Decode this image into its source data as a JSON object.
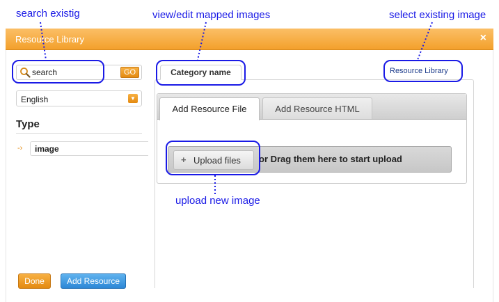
{
  "window": {
    "title": "Resource Library",
    "close_glyph": "×"
  },
  "sidebar": {
    "search_value": "search",
    "go_label": "GO",
    "language": "English",
    "type_heading": "Type",
    "type_items": [
      {
        "label": "image"
      }
    ]
  },
  "main": {
    "category_tab": "Category name",
    "resource_library_link": "Resource Library",
    "tabs": [
      {
        "label": "Add Resource File",
        "active": true
      },
      {
        "label": "Add Resource HTML",
        "active": false
      }
    ],
    "upload_button": "Upload files",
    "drop_text": "or Drag them here to start upload"
  },
  "footer": {
    "done_label": "Done",
    "add_resource_label": "Add Resource"
  },
  "annotations": {
    "search": "search existig",
    "view_edit": "view/edit mapped images",
    "select_existing": "select existing image",
    "upload_new": "upload new image"
  },
  "colors": {
    "accent_orange": "#f3a02c",
    "accent_blue": "#2c87d6",
    "annotation_blue": "#1a1ae6"
  }
}
